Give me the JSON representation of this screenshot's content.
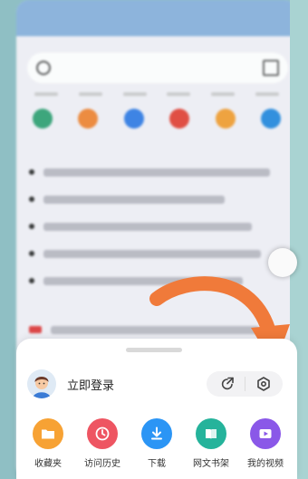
{
  "menu_sheet": {
    "login_label": "立即登录",
    "items": [
      {
        "label": "收藏夹",
        "icon": "folder-icon",
        "color": "#f7a234"
      },
      {
        "label": "访问历史",
        "icon": "clock-icon",
        "color": "#ee5562"
      },
      {
        "label": "下载",
        "icon": "download-icon",
        "color": "#2b95f5"
      },
      {
        "label": "网文书架",
        "icon": "book-icon",
        "color": "#25b39b"
      },
      {
        "label": "我的视频",
        "icon": "play-icon",
        "color": "#8a58e8"
      }
    ]
  },
  "colors": {
    "arrow": "#f07a3a",
    "sheet_background": "#ffffff"
  }
}
